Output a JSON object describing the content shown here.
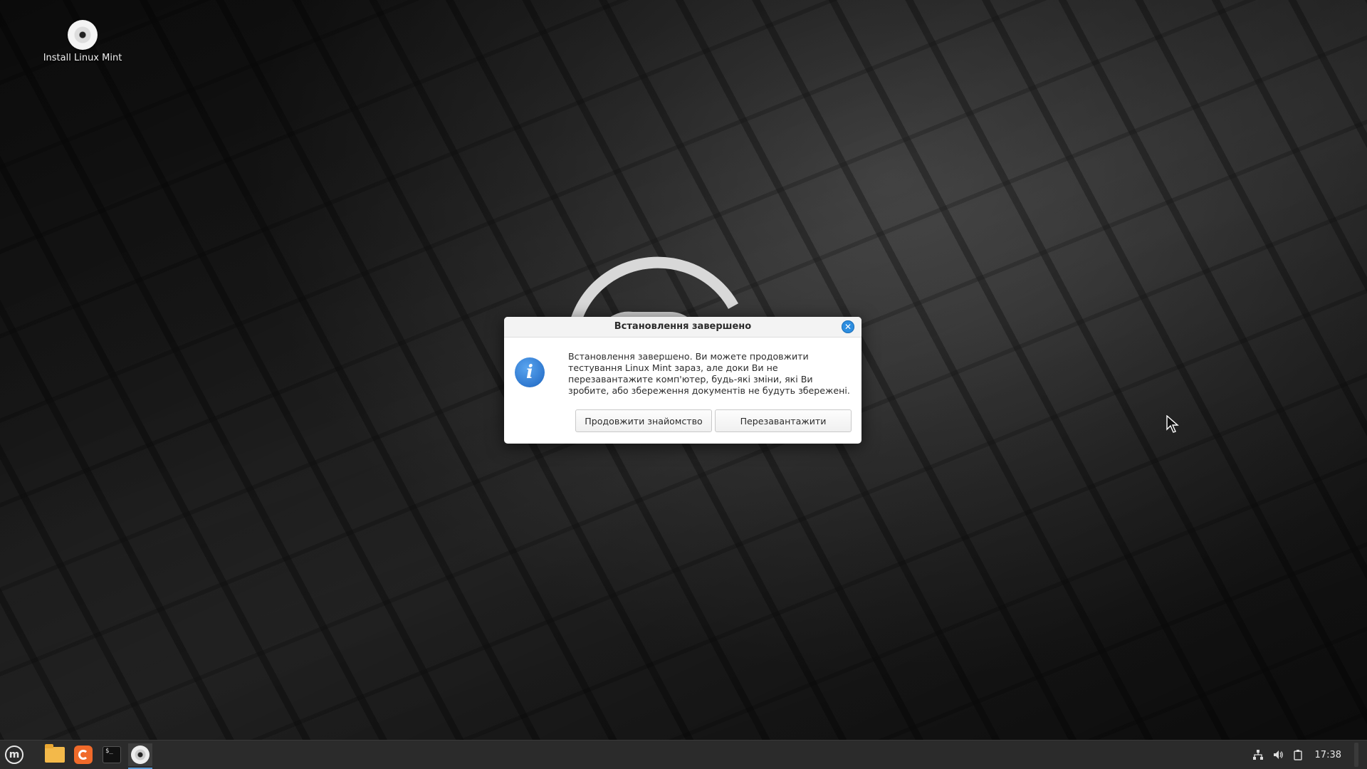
{
  "desktop": {
    "icons": [
      {
        "label": "Install Linux Mint",
        "icon": "disc-icon"
      }
    ]
  },
  "dialog": {
    "title": "Встановлення завершено",
    "message": "Встановлення завершено.  Ви можете продовжити тестування Linux Mint зараз, але доки Ви не перезавантажите комп'ютер, будь-які зміни, які Ви зробите, або  збереження документів не будуть збережені.",
    "icon": "info-icon",
    "buttons": {
      "continue_label": "Продовжити знайомство",
      "restart_label": "Перезавантажити"
    }
  },
  "taskbar": {
    "launchers": [
      "mint-menu-icon",
      "files-icon",
      "firefox-icon",
      "terminal-icon",
      "installer-icon"
    ],
    "tray": [
      "network-icon",
      "volume-icon",
      "clipboard-icon"
    ],
    "clock": "17:38"
  },
  "colors": {
    "accent": "#2e8ee0",
    "taskbar": "#2b2b2b"
  }
}
